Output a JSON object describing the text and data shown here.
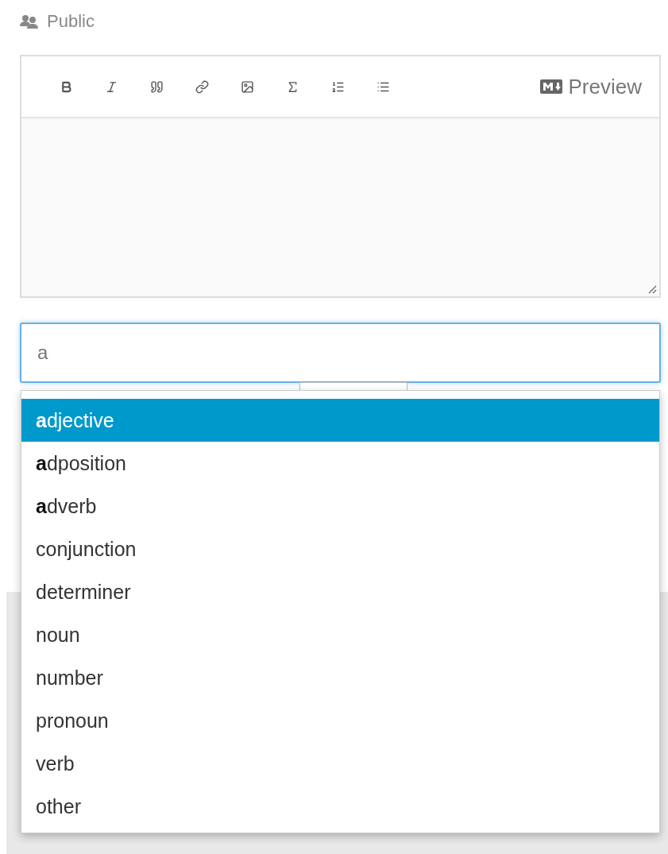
{
  "visibility": {
    "label": "Public"
  },
  "editor": {
    "toolbar": [
      {
        "kind": "bold"
      },
      {
        "kind": "italic"
      },
      {
        "kind": "quote"
      },
      {
        "kind": "link"
      },
      {
        "kind": "image"
      },
      {
        "kind": "formula"
      },
      {
        "kind": "numbered"
      },
      {
        "kind": "bulleted"
      }
    ],
    "preview": "Preview"
  },
  "tag_field": {
    "value": "a"
  },
  "suggestions": [
    {
      "label": "**a**djective",
      "selected": true
    },
    {
      "label": "**a**dposition",
      "selected": false
    },
    {
      "label": "**a**dverb",
      "selected": false
    },
    {
      "label": "conjunction",
      "selected": false
    },
    {
      "label": "determiner",
      "selected": false
    },
    {
      "label": "noun",
      "selected": false
    },
    {
      "label": "number",
      "selected": false
    },
    {
      "label": "pronoun",
      "selected": false
    },
    {
      "label": "verb",
      "selected": false
    },
    {
      "label": "other",
      "selected": false
    }
  ]
}
